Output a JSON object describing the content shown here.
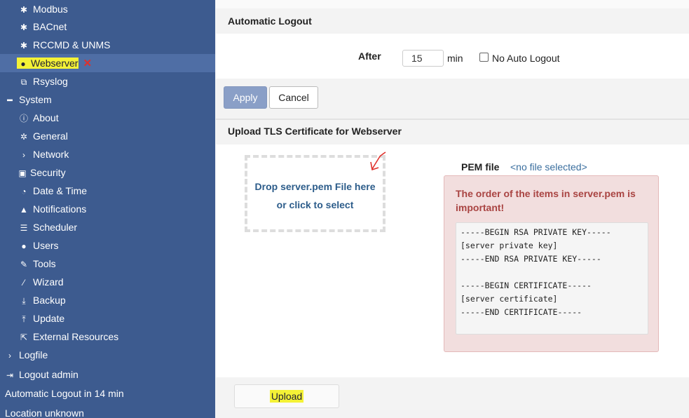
{
  "sidebar": {
    "items": [
      {
        "label": "Modbus",
        "icon": "gear-icon"
      },
      {
        "label": "BACnet",
        "icon": "gear-icon"
      },
      {
        "label": "RCCMD & UNMS",
        "icon": "gear-icon"
      },
      {
        "label": "Webserver",
        "icon": "globe-icon"
      },
      {
        "label": "Rsyslog",
        "icon": "copy-icon"
      },
      {
        "label": "System",
        "icon": "minus-icon"
      },
      {
        "label": "About",
        "icon": "info-circle-icon"
      },
      {
        "label": "General",
        "icon": "gears-icon"
      },
      {
        "label": "Network",
        "icon": "chevron-right-icon"
      },
      {
        "label": "Security",
        "icon": "lock-icon"
      },
      {
        "label": "Date & Time",
        "icon": "clock-icon"
      },
      {
        "label": "Notifications",
        "icon": "bell-icon"
      },
      {
        "label": "Scheduler",
        "icon": "list-icon"
      },
      {
        "label": "Users",
        "icon": "users-icon"
      },
      {
        "label": "Tools",
        "icon": "wrench-icon"
      },
      {
        "label": "Wizard",
        "icon": "magic-wand-icon"
      },
      {
        "label": "Backup",
        "icon": "download-icon"
      },
      {
        "label": "Update",
        "icon": "upload-icon"
      },
      {
        "label": "External Resources",
        "icon": "external-link-icon"
      },
      {
        "label": "Logfile",
        "icon": "chevron-right-icon"
      },
      {
        "label": "Logout admin",
        "icon": "sign-out-icon"
      }
    ],
    "status_autologout": "Automatic Logout in 14 min",
    "status_location": "Location unknown"
  },
  "logout_panel": {
    "title": "Automatic Logout",
    "after_label": "After",
    "minutes_value": "15",
    "min_unit": "min",
    "no_auto_logout_label": "No Auto Logout",
    "no_auto_logout_checked": false
  },
  "buttons": {
    "apply": "Apply",
    "cancel": "Cancel",
    "upload": "Upload"
  },
  "tls_panel": {
    "title": "Upload TLS Certificate for Webserver",
    "dropzone_line1": "Drop server.pem File here",
    "dropzone_line2": "or click to select",
    "pem_label": "PEM file",
    "pem_value": "<no file selected>",
    "alert_title": "The order of the items in server.pem is important!",
    "pem_template": "-----BEGIN RSA PRIVATE KEY-----\n[server private key]\n-----END RSA PRIVATE KEY-----\n\n-----BEGIN CERTIFICATE-----\n[server certificate]\n-----END CERTIFICATE-----"
  },
  "colors": {
    "sidebar_bg": "#3d5b8f",
    "active_item_bg": "#4f6ea5",
    "highlight": "#f4f236",
    "alert_bg": "#f2dede",
    "alert_text": "#a94442",
    "annotation_red": "#e0302b"
  }
}
